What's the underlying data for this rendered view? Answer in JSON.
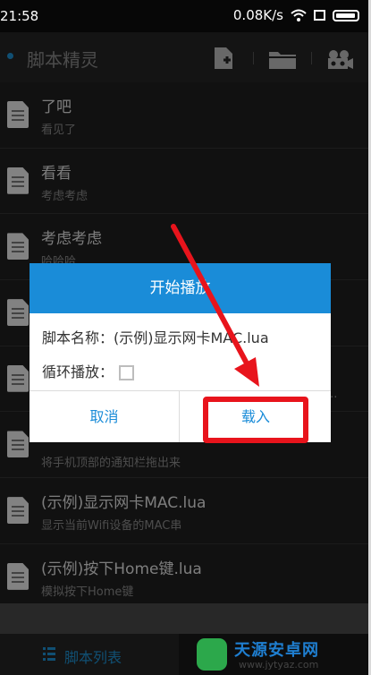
{
  "status_bar": {
    "time": "21:58",
    "speed": "0.08K/s"
  },
  "app_bar": {
    "title": "脚本精灵"
  },
  "scripts": [
    {
      "title": "了吧",
      "subtitle": "看见了"
    },
    {
      "title": "看看",
      "subtitle": "考虑考虑"
    },
    {
      "title": "考虑考虑",
      "subtitle": "哈哈哈"
    },
    {
      "title": "",
      "subtitle": ""
    },
    {
      "title": "",
      "subtitle": "经..."
    },
    {
      "title": "",
      "subtitle": "将手机顶部的通知栏拖出来"
    },
    {
      "title": "(示例)显示网卡MAC.lua",
      "subtitle": "显示当前Wifi设备的MAC串"
    },
    {
      "title": "(示例)按下Home键.lua",
      "subtitle": "模拟按下Home键"
    }
  ],
  "dialog": {
    "title": "开始播放",
    "script_name_label": "脚本名称：",
    "script_name_value": "(示例)显示网卡MAC.lua",
    "loop_label": "循环播放：",
    "loop_checked": false,
    "cancel_label": "取消",
    "load_label": "载入"
  },
  "tab_bar": {
    "script_list_label": "脚本列表"
  },
  "watermark": {
    "name": "天源安卓网",
    "url": "www.jytyaz.com"
  },
  "colors": {
    "accent": "#1a8cd8",
    "annotation": "#e8141c",
    "background": "#1f1f1f"
  }
}
